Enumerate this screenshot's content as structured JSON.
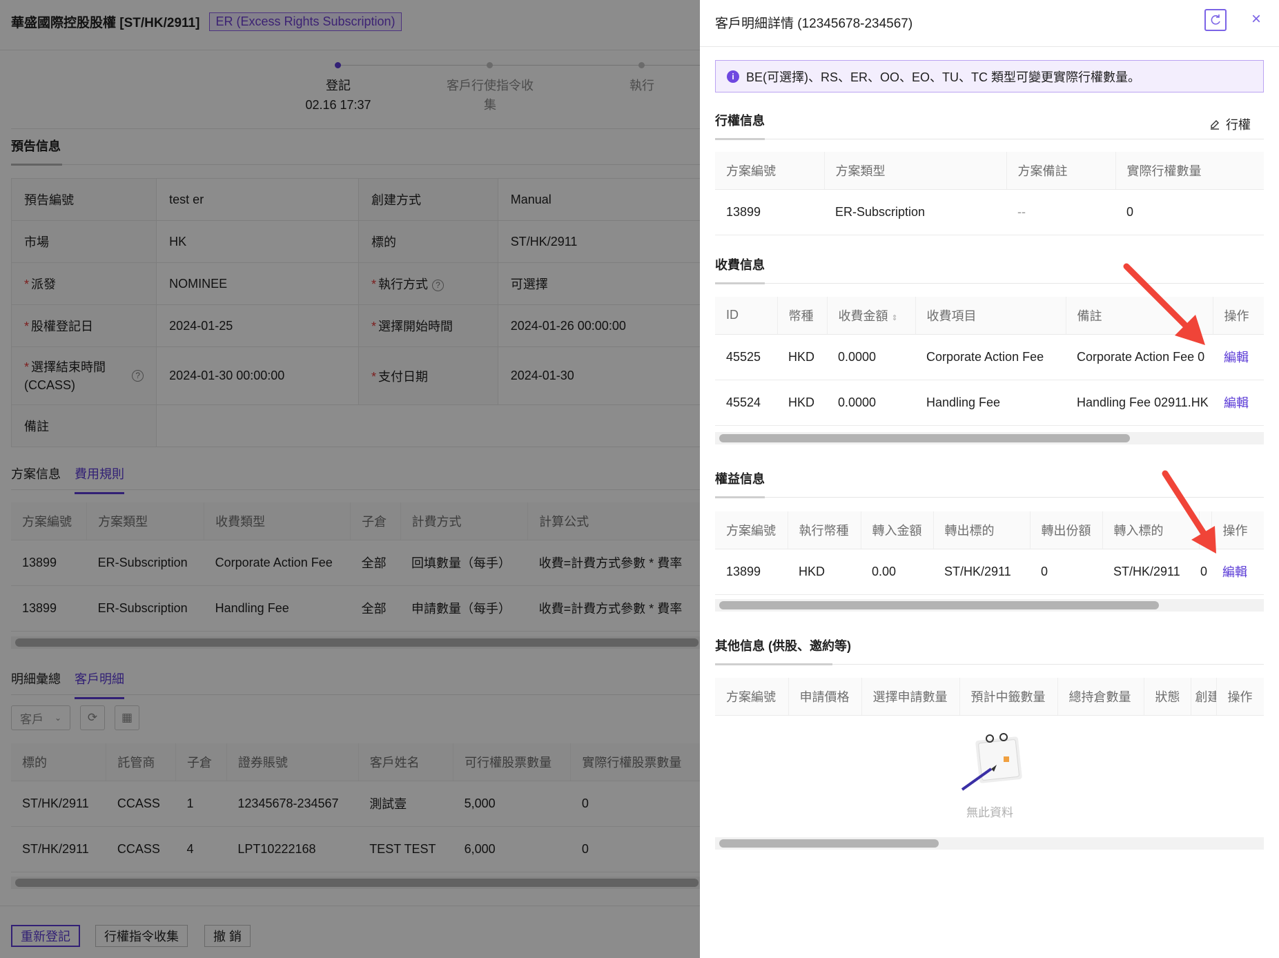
{
  "page": {
    "title": "華盛國際控股股權 [ST/HK/2911]",
    "tag": "ER (Excess Rights Subscription)",
    "steps": [
      {
        "label": "登記",
        "time": "02.16 17:37"
      },
      {
        "label": "客戶行使指令收",
        "label2": "集"
      },
      {
        "label": "執行"
      }
    ],
    "notice_section": "預告信息",
    "info": {
      "r1": {
        "l1": "預告編號",
        "v1": "test er",
        "l2": "創建方式",
        "v2": "Manual"
      },
      "r2": {
        "l1": "市場",
        "v1": "HK",
        "l2": "標的",
        "v2": "ST/HK/2911"
      },
      "r3": {
        "l1": "派發",
        "v1": "NOMINEE",
        "l2": "執行方式",
        "v2": "可選擇"
      },
      "r4": {
        "l1": "股權登記日",
        "v1": "2024-01-25",
        "l2": "選擇開始時間",
        "v2": "2024-01-26 00:00:00"
      },
      "r5": {
        "l1": "選擇結束時間",
        "l1b": "(CCASS)",
        "v1": "2024-01-30 00:00:00",
        "l2": "支付日期",
        "v2": "2024-01-30"
      },
      "r6": {
        "l1": "備註",
        "v1": ""
      }
    },
    "tabs1": [
      "方案信息",
      "費用規則"
    ],
    "fee_rules": {
      "headers": [
        "方案編號",
        "方案類型",
        "收費類型",
        "子倉",
        "計費方式",
        "計算公式"
      ],
      "rows": [
        [
          "13899",
          "ER-Subscription",
          "Corporate Action Fee",
          "全部",
          "回填數量（每手）",
          "收費=計費方式參數 * 費率"
        ],
        [
          "13899",
          "ER-Subscription",
          "Handling Fee",
          "全部",
          "申請數量（每手）",
          "收費=計費方式參數 * 費率"
        ]
      ]
    },
    "tabs2": [
      "明細彙總",
      "客戶明細"
    ],
    "filter_select": "客戶",
    "clients": {
      "headers": [
        "標的",
        "託管商",
        "子倉",
        "證券賬號",
        "客戶姓名",
        "可行權股票數量",
        "實際行權股票數量"
      ],
      "rows": [
        [
          "ST/HK/2911",
          "CCASS",
          "1",
          "12345678-234567",
          "測試壹",
          "5,000",
          "0"
        ],
        [
          "ST/HK/2911",
          "CCASS",
          "4",
          "LPT10222168",
          "TEST TEST",
          "6,000",
          "0"
        ]
      ]
    },
    "footer": {
      "reregister": "重新登記",
      "collect": "行權指令收集",
      "revoke": "撤 銷"
    }
  },
  "drawer": {
    "title": "客戶明細詳情 (12345678-234567)",
    "alert": "BE(可選擇)、RS、ER、OO、EO、TU、TC 類型可變更實際行權數量。",
    "exercise": {
      "title": "行權信息",
      "action": "行權",
      "headers": [
        "方案編號",
        "方案類型",
        "方案備註",
        "實際行權數量"
      ],
      "row": [
        "13899",
        "ER-Subscription",
        "--",
        "0"
      ]
    },
    "fees": {
      "title": "收費信息",
      "headers": [
        "ID",
        "幣種",
        "收費金額",
        "收費項目",
        "備註",
        "操作"
      ],
      "rows": [
        [
          "45525",
          "HKD",
          "0.0000",
          "Corporate Action Fee",
          "Corporate Action Fee 0",
          "編輯"
        ],
        [
          "45524",
          "HKD",
          "0.0000",
          "Handling Fee",
          "Handling Fee 02911.HK",
          "編輯"
        ]
      ]
    },
    "rights": {
      "title": "權益信息",
      "headers": [
        "方案編號",
        "執行幣種",
        "轉入金額",
        "轉出標的",
        "轉出份額",
        "轉入標的",
        "操作"
      ],
      "row": [
        "13899",
        "HKD",
        "0.00",
        "ST/HK/2911",
        "0",
        "ST/HK/2911",
        "0",
        "編輯"
      ]
    },
    "other": {
      "title": "其他信息 (供股、邀約等)",
      "headers": [
        "方案編號",
        "申請價格",
        "選擇申請數量",
        "預計中籤數量",
        "總持倉數量",
        "狀態",
        "創建",
        "操作"
      ],
      "empty": "無此資料"
    }
  },
  "colors": {
    "accent": "#5b3bd6",
    "arrow": "#f04438"
  }
}
